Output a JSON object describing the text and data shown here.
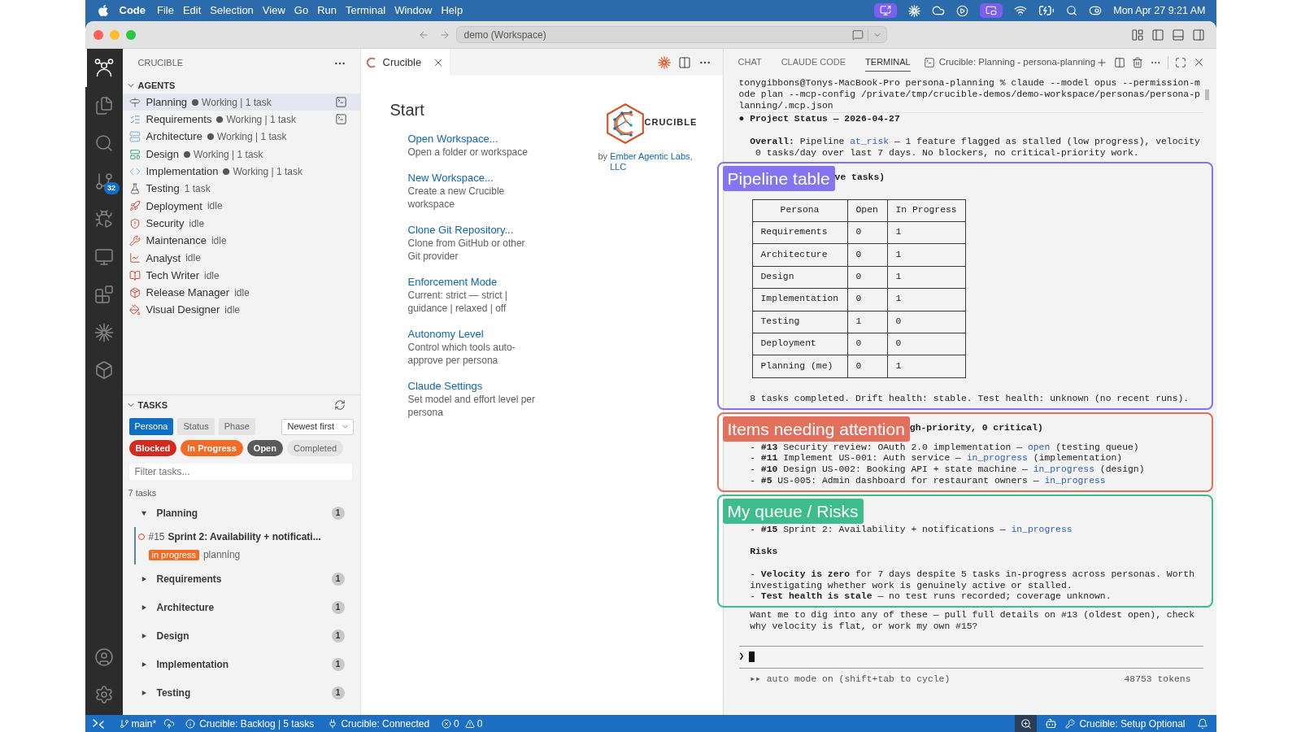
{
  "menu_bar": {
    "app": "Code",
    "menus": [
      "File",
      "Edit",
      "Selection",
      "View",
      "Go",
      "Run",
      "Terminal",
      "Window",
      "Help"
    ],
    "clock": "Mon Apr 27 9:21 AM"
  },
  "title_bar": {
    "command_center": "demo (Workspace)"
  },
  "activity_bar": {
    "items": [
      {
        "selected": true
      },
      {
        "selected": false
      },
      {
        "selected": false
      },
      {
        "selected": false,
        "badge": "32"
      },
      {
        "selected": false
      },
      {
        "selected": false
      },
      {
        "selected": false
      },
      {
        "selected": false
      },
      {
        "selected": false
      }
    ]
  },
  "sidebar": {
    "title": "CRUCIBLE",
    "agents": {
      "title": "AGENTS",
      "expanded": true,
      "items": [
        {
          "name": "Planning",
          "status": "Working | 1 task",
          "busy": true,
          "selected": true,
          "terminal": true
        },
        {
          "name": "Requirements",
          "status": "Working | 1 task",
          "busy": true,
          "selected": false,
          "terminal": true
        },
        {
          "name": "Architecture",
          "status": "Working | 1 task",
          "busy": true,
          "selected": false,
          "terminal": false
        },
        {
          "name": "Design",
          "status": "Working | 1 task",
          "busy": true,
          "selected": false,
          "terminal": false
        },
        {
          "name": "Implementation",
          "status": "Working | 1 task",
          "busy": true,
          "selected": false,
          "terminal": false
        },
        {
          "name": "Testing",
          "status": "1 task",
          "busy": false,
          "selected": false,
          "terminal": false
        },
        {
          "name": "Deployment",
          "status": "idle",
          "busy": false,
          "selected": false,
          "terminal": false
        },
        {
          "name": "Security",
          "status": "idle",
          "busy": false,
          "selected": false,
          "terminal": false
        },
        {
          "name": "Maintenance",
          "status": "idle",
          "busy": false,
          "selected": false,
          "terminal": false
        },
        {
          "name": "Analyst",
          "status": "idle",
          "busy": false,
          "selected": false,
          "terminal": false
        },
        {
          "name": "Tech Writer",
          "status": "idle",
          "busy": false,
          "selected": false,
          "terminal": false
        },
        {
          "name": "Release Manager",
          "status": "idle",
          "busy": false,
          "selected": false,
          "terminal": false
        },
        {
          "name": "Visual Designer",
          "status": "idle",
          "busy": false,
          "selected": false,
          "terminal": false
        }
      ]
    },
    "tasks": {
      "title": "TASKS",
      "expanded": true,
      "group_by": [
        {
          "label": "Persona",
          "selected": true
        },
        {
          "label": "Status",
          "selected": false
        },
        {
          "label": "Phase",
          "selected": false
        }
      ],
      "sort": "Newest first",
      "filters": [
        {
          "label": "Blocked",
          "selected": true,
          "color": "#d42a1e"
        },
        {
          "label": "In Progress",
          "selected": true,
          "color": "#f26a24"
        },
        {
          "label": "Open",
          "selected": true,
          "color": "#5a5a5a"
        },
        {
          "label": "Completed",
          "selected": false
        }
      ],
      "search": {
        "placeholder": "Filter tasks..."
      },
      "count": "7 tasks",
      "groups": [
        {
          "name": "Planning",
          "count": "1",
          "expanded": true,
          "tasks": [
            {
              "number": "#15",
              "title": "Sprint 2: Availability + notificati...",
              "status": "in progress",
              "persona": "planning"
            }
          ]
        },
        {
          "name": "Requirements",
          "count": "1",
          "expanded": false
        },
        {
          "name": "Architecture",
          "count": "1",
          "expanded": false
        },
        {
          "name": "Design",
          "count": "1",
          "expanded": false
        },
        {
          "name": "Implementation",
          "count": "1",
          "expanded": false
        },
        {
          "name": "Testing",
          "count": "1",
          "expanded": false
        }
      ]
    }
  },
  "editor": {
    "tabs": [
      {
        "label": "Crucible",
        "selected": true
      }
    ],
    "heading": "Start",
    "actions": [
      {
        "label": "Open Workspace...",
        "description": "Open a folder or workspace"
      },
      {
        "label": "New Workspace...",
        "description": "Create a new Crucible workspace"
      },
      {
        "label": "Clone Git Repository...",
        "description": "Clone from GitHub or other Git provider"
      },
      {
        "label": "Enforcement Mode",
        "description": "Current: strict — strict | guidance | relaxed | off"
      },
      {
        "label": "Autonomy Level",
        "description": "Control which tools auto-approve per persona"
      },
      {
        "label": "Claude Settings",
        "description": "Set model and effort level per persona"
      }
    ],
    "brand": {
      "logo_text": "CRUCIBLE",
      "by": "by",
      "publisher": "Ember Agentic Labs, LLC"
    }
  },
  "panel": {
    "tabs": [
      {
        "label": "CHAT",
        "selected": false
      },
      {
        "label": "CLAUDE CODE",
        "selected": false
      },
      {
        "label": "TERMINAL",
        "selected": true
      }
    ],
    "terminal_title": "Crucible: Planning - persona-planning",
    "terminal": {
      "command": [
        "tonygibbons@Tonys-MacBook-Pro persona-planning % claude --model opus --permission-m",
        "ode plan --mcp-config /private/tmp/crucible-demos/demo-workspace/personas/persona-p",
        "lanning/.mcp.json"
      ],
      "output": [
        {
          "kind": "message",
          "text": "● Project Status — 2026-04-27"
        },
        {
          "kind": "paragraph",
          "lines": [
            [
              {
                "text": "**Overall:** Pipeline "
              },
              {
                "text": "at_risk",
                "highlight": true
              },
              {
                "text": " — 1 feature flagged as stalled (low progress), velocity"
              }
            ],
            [
              {
                "text": " 0 tasks/day over last 7 days. No blockers, no critical-priority work."
              }
            ]
          ]
        },
        {
          "kind": "annotation",
          "label": "Pipeline table",
          "color": "#8574f2",
          "heading": "ve tasks)",
          "body": [
            {
              "kind": "table",
              "columns": [
                "Persona",
                "Open",
                "In Progress"
              ],
              "rows": [
                [
                  "Requirements",
                  "0",
                  "1"
                ],
                [
                  "Architecture",
                  "0",
                  "1"
                ],
                [
                  "Design",
                  "0",
                  "1"
                ],
                [
                  "Implementation",
                  "0",
                  "1"
                ],
                [
                  "Testing",
                  "1",
                  "0"
                ],
                [
                  "Deployment",
                  "0",
                  "0"
                ],
                [
                  "Planning (me)",
                  "0",
                  "1"
                ]
              ]
            },
            {
              "kind": "paragraph",
              "lines": [
                [
                  {
                    "text": "8 tasks completed. Drift health: stable. Test health: unknown (no recent runs)."
                  }
                ]
              ]
            }
          ]
        },
        {
          "kind": "annotation",
          "label": "Items needing attention",
          "color": "#e2705d",
          "heading": "gh-priority, 0 critical)",
          "body": [
            {
              "kind": "paragraph",
              "lines": [
                [
                  {
                    "text": "- **#13** Security review: OAuth 2.0 implementation — "
                  },
                  {
                    "text": "open",
                    "highlight": true
                  },
                  {
                    "text": " (testing queue)"
                  }
                ],
                [
                  {
                    "text": "- **#11** Implement US-001: Auth service — "
                  },
                  {
                    "text": "in_progress",
                    "highlight": true
                  },
                  {
                    "text": " (implementation)"
                  }
                ],
                [
                  {
                    "text": "- **#10** Design US-002: Booking API + state machine — "
                  },
                  {
                    "text": "in_progress",
                    "highlight": true
                  },
                  {
                    "text": " (design)"
                  }
                ],
                [
                  {
                    "text": "- **#5** US-005: Admin dashboard for restaurant owners — "
                  },
                  {
                    "text": "in_progress",
                    "highlight": true
                  }
                ]
              ]
            }
          ]
        },
        {
          "kind": "annotation",
          "label": "My queue / Risks",
          "color": "#3dbd8e",
          "body": [
            {
              "kind": "paragraph",
              "lines": [
                [
                  {
                    "text": "- **#15** Sprint 2: Availability + notifications — "
                  },
                  {
                    "text": "in_progress",
                    "highlight": true
                  }
                ]
              ]
            },
            {
              "kind": "heading",
              "text": "Risks"
            },
            {
              "kind": "paragraph",
              "lines": [
                [
                  {
                    "text": "- **Velocity is zero** for 7 days despite 5 tasks in-progress across personas. Worth"
                  }
                ],
                [
                  {
                    "text": "investigating whether work is genuinely active or stalled."
                  }
                ],
                [
                  {
                    "text": "- **Test health is stale** — no test runs recorded; coverage unknown."
                  }
                ]
              ]
            }
          ]
        },
        {
          "kind": "paragraph",
          "lines": [
            [
              {
                "text": "Want me to dig into any of these — pull full details on #13 (oldest open), check"
              }
            ],
            [
              {
                "text": "why velocity is flat, or work my own #15?"
              }
            ]
          ]
        }
      ],
      "prompt": "❯",
      "mode": "▸▸ auto mode on (shift+tab to cycle)",
      "tokens": "48753 tokens"
    }
  },
  "status_bar": {
    "branch": "main*",
    "backlog": "Crucible: Backlog | 5 tasks",
    "connection": "Crucible: Connected",
    "errors": "0",
    "warnings": "0",
    "setup": "Crucible: Setup Optional"
  }
}
